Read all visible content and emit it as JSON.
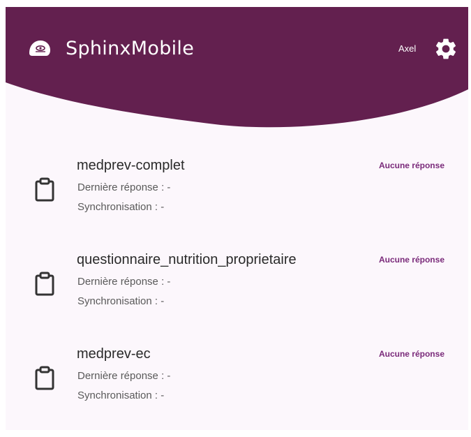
{
  "header": {
    "app_name": "SphinxMobile",
    "user_name": "Axel",
    "logo_icon": "sphinx-logo-icon",
    "settings_icon": "gear-icon",
    "color": "#63204f"
  },
  "surveys": [
    {
      "name": "medprev-complet",
      "last_response": "Dernière réponse : -",
      "sync": "Synchronisation : -",
      "status": "Aucune réponse",
      "icon": "clipboard-icon"
    },
    {
      "name": "questionnaire_nutrition_proprietaire",
      "last_response": "Dernière réponse : -",
      "sync": "Synchronisation : -",
      "status": "Aucune réponse",
      "icon": "clipboard-icon"
    },
    {
      "name": "medprev-ec",
      "last_response": "Dernière réponse : -",
      "sync": "Synchronisation : -",
      "status": "Aucune réponse",
      "icon": "clipboard-icon"
    }
  ],
  "colors": {
    "header": "#63204f",
    "background": "#fcf7fc",
    "status_accent": "#7a2a7a"
  }
}
